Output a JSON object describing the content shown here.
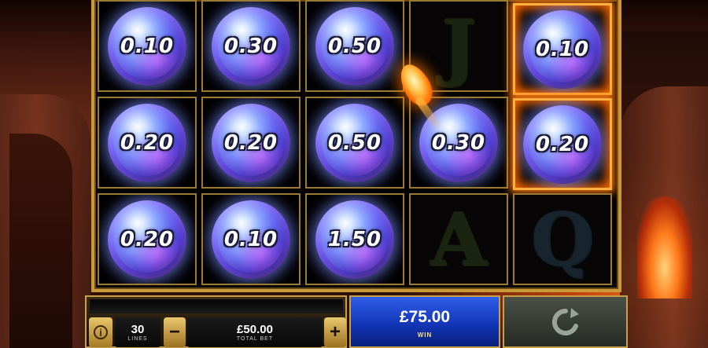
{
  "reels": {
    "row1": [
      {
        "kind": "orb",
        "value": "0.10"
      },
      {
        "kind": "orb",
        "value": "0.30"
      },
      {
        "kind": "orb",
        "value": "0.50"
      },
      {
        "kind": "symbol",
        "value": "J"
      },
      {
        "kind": "orb",
        "value": "0.10",
        "highlight": "fire"
      }
    ],
    "row2": [
      {
        "kind": "orb",
        "value": "0.20"
      },
      {
        "kind": "orb",
        "value": "0.20"
      },
      {
        "kind": "orb",
        "value": "0.50"
      },
      {
        "kind": "orb",
        "value": "0.30"
      },
      {
        "kind": "orb",
        "value": "0.20",
        "highlight": "fire"
      }
    ],
    "row3": [
      {
        "kind": "orb",
        "value": "0.20"
      },
      {
        "kind": "orb",
        "value": "0.10"
      },
      {
        "kind": "orb",
        "value": "1.50"
      },
      {
        "kind": "symbol",
        "value": "A"
      },
      {
        "kind": "symbol",
        "value": "Q"
      }
    ]
  },
  "controls": {
    "info_icon": "info-icon",
    "lines_value": "30",
    "lines_label": "LINES",
    "minus_label": "−",
    "plus_label": "+",
    "total_bet_value": "£50.00",
    "total_bet_label": "TOTAL BET",
    "win_value": "£75.00",
    "win_label": "WIN",
    "spin_icon": "spin-icon"
  },
  "colors": {
    "frame_gold": "#c99a3a",
    "win_blue": "#1336b8",
    "fire_orange": "#ff7a10"
  }
}
